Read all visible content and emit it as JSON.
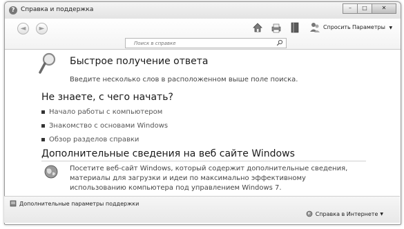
{
  "window": {
    "title": "Справка и поддержка"
  },
  "toolbar": {
    "back_glyph": "◄",
    "forward_glyph": "►",
    "ask_label": "Спросить",
    "options_label": "Параметры",
    "options_arrow": "▼",
    "icons": [
      "home-icon",
      "print-icon",
      "browse-help-icon",
      "ask-icon"
    ]
  },
  "search": {
    "placeholder": "Поиск в справке"
  },
  "quick_answer": {
    "heading": "Быстрое получение ответа",
    "description": "Введите несколько слов в расположенном выше поле поиска."
  },
  "getting_started": {
    "heading": "Не знаете, с чего начать?",
    "links": [
      "Начало работы с компьютером",
      "Знакомство с основами Windows",
      "Обзор разделов справки"
    ]
  },
  "online_info": {
    "heading": "Дополнительные сведения на веб сайте Windows",
    "description": "Посетите веб-сайт Windows, который содержит дополнительные сведения, материалы для загрузки и идеи по максимально эффективному использованию компьютера под управлением Windows 7."
  },
  "statusbar": {
    "support_options": "Дополнительные параметры поддержки",
    "online_help": "Справка в Интернете",
    "online_help_arrow": "▼"
  }
}
